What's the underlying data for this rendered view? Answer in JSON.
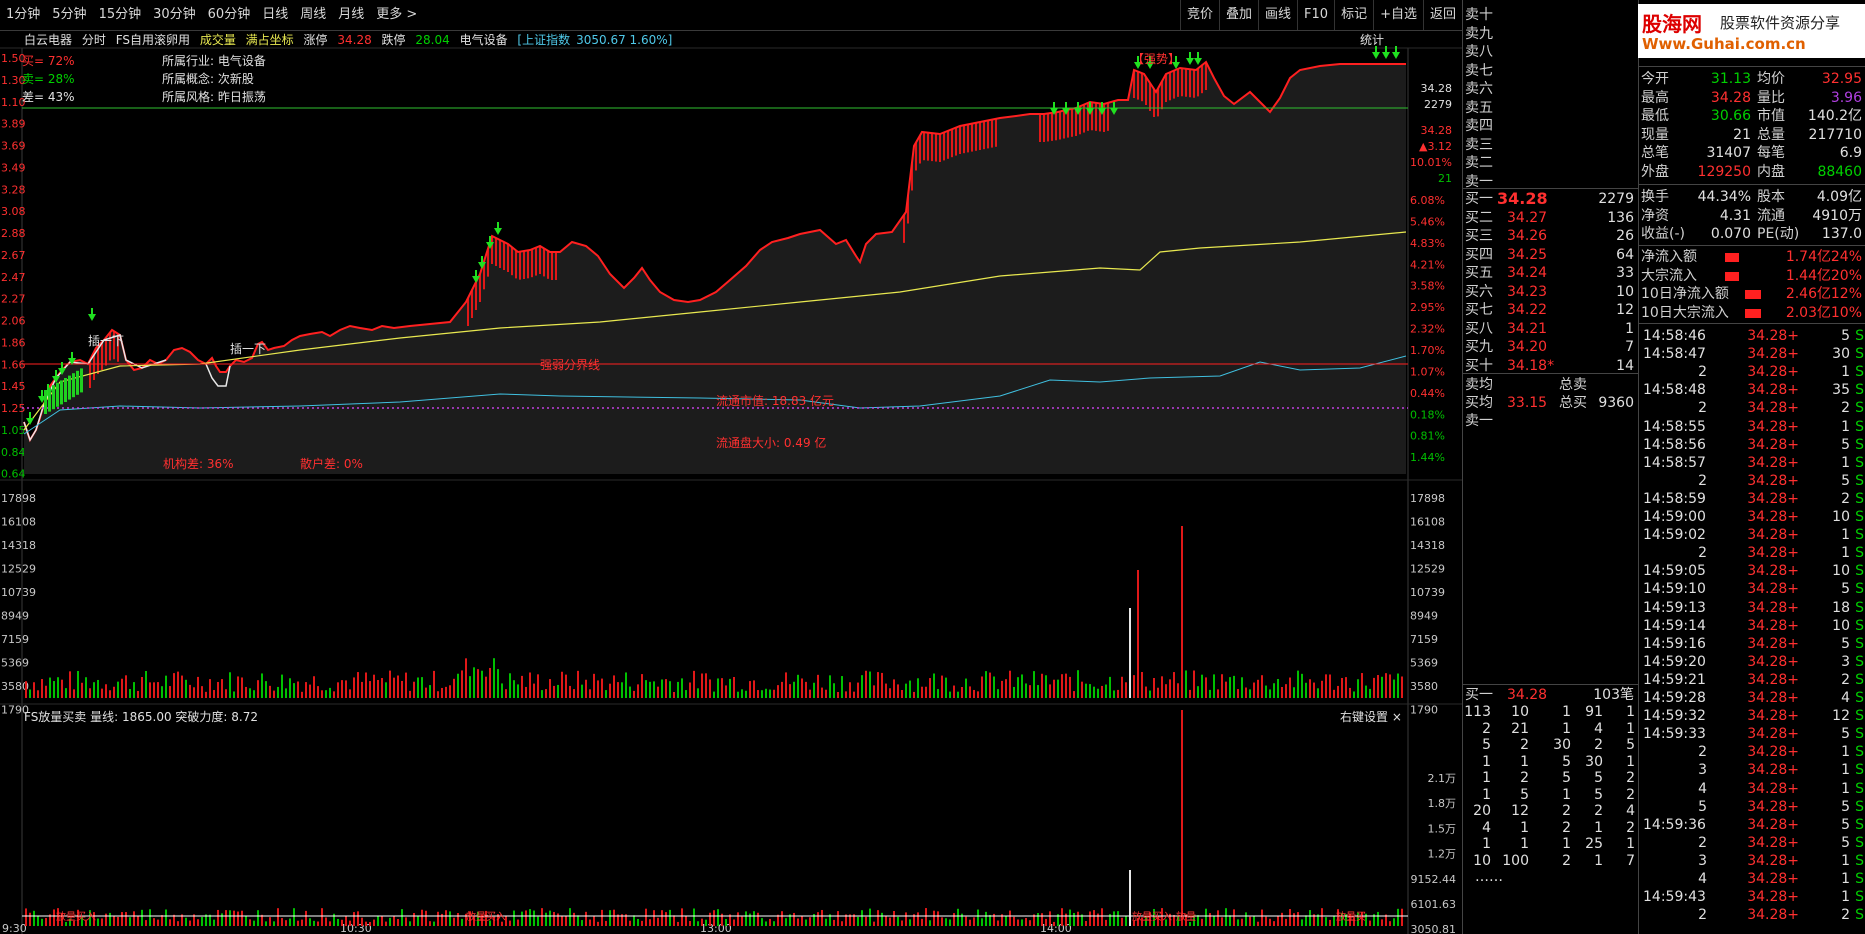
{
  "timeframes": [
    "1分钟",
    "5分钟",
    "15分钟",
    "30分钟",
    "60分钟",
    "日线",
    "周线",
    "月线",
    "更多 >"
  ],
  "toolbar": [
    "竞价",
    "叠加",
    "画线",
    "F10",
    "标记",
    "+自选",
    "返回"
  ],
  "info": {
    "stock_name": "白云电器",
    "mode": "分时",
    "formula": "FS自用滚卵用",
    "items": [
      "成交量",
      "满占坐标",
      "涨停"
    ],
    "limit_up": "34.28",
    "limit_down_label": "跌停",
    "limit_down": "28.04",
    "sector": "电气设备",
    "index_label": "[上证指数",
    "index_value": "3050.67 1.60%]",
    "stats_label": "统计"
  },
  "overlay": {
    "buy_label": "买= 72%",
    "sell_label": "卖= 28%",
    "diff_label": "差= 43%",
    "industry": "所属行业: 电气设备",
    "concept": "所属概念: 次新股",
    "style": "所属风格: 昨日振荡",
    "strong_label": "【强势】",
    "knock1": "插一下",
    "knock2": "插一下",
    "boundary": "强弱分界线",
    "float_mv": "流通市值: 18.83 亿元",
    "float_size": "流通盘大小: 0.49 亿",
    "inst": "机构差: 36%",
    "retail": "散户差: 0%"
  },
  "left_axis": [
    "1.50",
    "1.30",
    "1.10",
    "3.89",
    "3.69",
    "3.49",
    "3.28",
    "3.08",
    "2.88",
    "2.67",
    "2.47",
    "2.27",
    "2.06",
    "1.86",
    "1.66",
    "1.45",
    "1.25",
    "1.05",
    "0.84",
    "0.64"
  ],
  "right_axis_pct": [
    "6.08%",
    "5.46%",
    "4.83%",
    "4.21%",
    "3.58%",
    "2.95%",
    "2.32%",
    "1.70%",
    "1.07%",
    "0.44%",
    "0.18%",
    "0.81%",
    "1.44%"
  ],
  "right_top_values": [
    "34.28",
    "2279",
    "34.28",
    "▲3.12",
    "10.01%",
    "21"
  ],
  "vol_axis_left": [
    "17898",
    "16108",
    "14318",
    "12529",
    "10739",
    "8949",
    "7159",
    "5369",
    "3580",
    "1790"
  ],
  "vol_axis_right": [
    "17898",
    "16108",
    "14318",
    "12529",
    "10739",
    "8949",
    "7159",
    "5369",
    "3580",
    "1790"
  ],
  "sub_chart": {
    "title": "FS放量买卖 量线: 1865.00 突破力度: 8.72",
    "right_settings": "右键设置 ×",
    "axis": [
      "2.1万",
      "1.8万",
      "1.5万",
      "1.2万",
      "9152.44",
      "6101.63",
      "3050.81"
    ],
    "labels": [
      "放量买入",
      "放量买入",
      "放量买入",
      "放量",
      "放量买"
    ]
  },
  "time_axis": [
    "9:30",
    "10:30",
    "13:00",
    "14:00"
  ],
  "colors": {
    "up": "#ff2020",
    "down": "#00c000",
    "avg": "#e8e850",
    "cyan": "#40c0e0",
    "bg": "#000000"
  },
  "ask": [
    {
      "label": "卖十",
      "price": "",
      "vol": ""
    },
    {
      "label": "卖九",
      "price": "",
      "vol": ""
    },
    {
      "label": "卖八",
      "price": "",
      "vol": ""
    },
    {
      "label": "卖七",
      "price": "",
      "vol": ""
    },
    {
      "label": "卖六",
      "price": "",
      "vol": ""
    },
    {
      "label": "卖五",
      "price": "",
      "vol": ""
    },
    {
      "label": "卖四",
      "price": "",
      "vol": ""
    },
    {
      "label": "卖三",
      "price": "",
      "vol": ""
    },
    {
      "label": "卖二",
      "price": "",
      "vol": ""
    },
    {
      "label": "卖一",
      "price": "",
      "vol": ""
    }
  ],
  "bid": [
    {
      "label": "买一",
      "price": "34.28",
      "vol": "2279"
    },
    {
      "label": "买二",
      "price": "34.27",
      "vol": "136"
    },
    {
      "label": "买三",
      "price": "34.26",
      "vol": "26"
    },
    {
      "label": "买四",
      "price": "34.25",
      "vol": "64"
    },
    {
      "label": "买五",
      "price": "34.24",
      "vol": "33"
    },
    {
      "label": "买六",
      "price": "34.23",
      "vol": "10"
    },
    {
      "label": "买七",
      "price": "34.22",
      "vol": "12"
    },
    {
      "label": "买八",
      "price": "34.21",
      "vol": "1"
    },
    {
      "label": "买九",
      "price": "34.20",
      "vol": "7"
    },
    {
      "label": "买十",
      "price": "34.18*",
      "vol": "14"
    }
  ],
  "avg_rows": {
    "sell_avg": "卖均",
    "sell_total": "总卖",
    "buy_avg": "买均",
    "buy_avg_val": "33.15",
    "buy_total": "总买",
    "buy_total_val": "9360",
    "sell_one": "卖一"
  },
  "quote": [
    [
      "今开",
      "31.13",
      "均价",
      "32.95"
    ],
    [
      "最高",
      "34.28",
      "量比",
      "3.96"
    ],
    [
      "最低",
      "30.66",
      "市值",
      "140.2亿"
    ],
    [
      "现量",
      "21",
      "总量",
      "217710"
    ],
    [
      "总笔",
      "31407",
      "每笔",
      "6.9"
    ],
    [
      "外盘",
      "129250",
      "内盘",
      "88460"
    ]
  ],
  "quote2": [
    [
      "换手",
      "44.34%",
      "股本",
      "4.09亿"
    ],
    [
      "净资",
      "4.31",
      "流通",
      "4910万"
    ],
    [
      "收益(-)",
      "0.070",
      "PE(动)",
      "137.0"
    ]
  ],
  "flows": [
    [
      "净流入额",
      "1.74亿",
      "24%"
    ],
    [
      "大宗流入",
      "1.44亿",
      "20%"
    ],
    [
      "10日净流入额",
      "2.46亿",
      "12%"
    ],
    [
      "10日大宗流入",
      "2.03亿",
      "10%"
    ]
  ],
  "queue_header": {
    "label": "买一",
    "price": "34.28",
    "count": "103笔"
  },
  "queue": [
    [
      "113",
      "10",
      "1",
      "91",
      "1"
    ],
    [
      "2",
      "21",
      "1",
      "4",
      "1"
    ],
    [
      "5",
      "2",
      "30",
      "2",
      "5"
    ],
    [
      "1",
      "1",
      "5",
      "30",
      "1"
    ],
    [
      "1",
      "2",
      "5",
      "5",
      "2"
    ],
    [
      "1",
      "5",
      "1",
      "5",
      "2"
    ],
    [
      "20",
      "12",
      "2",
      "2",
      "4"
    ],
    [
      "4",
      "1",
      "2",
      "1",
      "2"
    ],
    [
      "1",
      "1",
      "1",
      "25",
      "1"
    ],
    [
      "10",
      "100",
      "2",
      "1",
      "7"
    ],
    [
      "……",
      "",
      "",
      "",
      ""
    ]
  ],
  "ticks": [
    [
      "14:58:46",
      "34.28+",
      "5",
      "S"
    ],
    [
      "14:58:47",
      "34.28+",
      "30",
      "S"
    ],
    [
      "2",
      "34.28+",
      "1",
      "S"
    ],
    [
      "14:58:48",
      "34.28+",
      "35",
      "S"
    ],
    [
      "2",
      "34.28+",
      "2",
      "S"
    ],
    [
      "14:58:55",
      "34.28+",
      "1",
      "S"
    ],
    [
      "14:58:56",
      "34.28+",
      "5",
      "S"
    ],
    [
      "14:58:57",
      "34.28+",
      "1",
      "S"
    ],
    [
      "2",
      "34.28+",
      "5",
      "S"
    ],
    [
      "14:58:59",
      "34.28+",
      "2",
      "S"
    ],
    [
      "14:59:00",
      "34.28+",
      "10",
      "S"
    ],
    [
      "14:59:02",
      "34.28+",
      "1",
      "S"
    ],
    [
      "2",
      "34.28+",
      "1",
      "S"
    ],
    [
      "14:59:05",
      "34.28+",
      "10",
      "S"
    ],
    [
      "14:59:10",
      "34.28+",
      "5",
      "S"
    ],
    [
      "14:59:13",
      "34.28+",
      "18",
      "S"
    ],
    [
      "14:59:14",
      "34.28+",
      "10",
      "S"
    ],
    [
      "14:59:16",
      "34.28+",
      "5",
      "S"
    ],
    [
      "14:59:20",
      "34.28+",
      "3",
      "S"
    ],
    [
      "14:59:21",
      "34.28+",
      "2",
      "S"
    ],
    [
      "14:59:28",
      "34.28+",
      "4",
      "S"
    ],
    [
      "14:59:32",
      "34.28+",
      "12",
      "S"
    ],
    [
      "14:59:33",
      "34.28+",
      "5",
      "S"
    ],
    [
      "2",
      "34.28+",
      "1",
      "S"
    ],
    [
      "3",
      "34.28+",
      "1",
      "S"
    ],
    [
      "4",
      "34.28+",
      "1",
      "S"
    ],
    [
      "5",
      "34.28+",
      "5",
      "S"
    ],
    [
      "14:59:36",
      "34.28+",
      "5",
      "S"
    ],
    [
      "2",
      "34.28+",
      "5",
      "S"
    ],
    [
      "3",
      "34.28+",
      "1",
      "S"
    ],
    [
      "4",
      "34.28+",
      "1",
      "S"
    ],
    [
      "14:59:43",
      "34.28+",
      "1",
      "S"
    ],
    [
      "2",
      "34.28+",
      "2",
      "S"
    ],
    [
      "14:59:44",
      "34.28+",
      "1",
      "S"
    ]
  ],
  "logo": {
    "name": "股海网",
    "slogan": "股票软件资源分享",
    "url": "Www.Guhai.com.cn"
  }
}
